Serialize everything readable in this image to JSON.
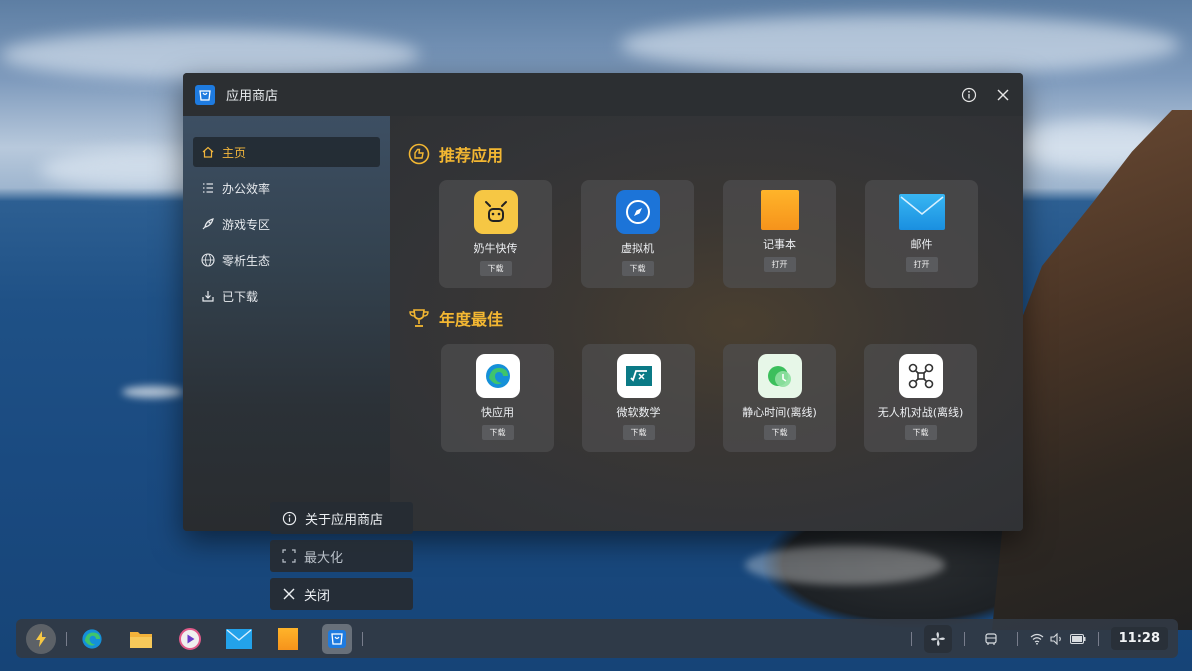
{
  "window": {
    "title": "应用商店"
  },
  "sidebar": {
    "items": [
      {
        "label": "主页",
        "icon": "home-icon",
        "active": true
      },
      {
        "label": "办公效率",
        "icon": "list-icon"
      },
      {
        "label": "游戏专区",
        "icon": "rocket-icon"
      },
      {
        "label": "零析生态",
        "icon": "www-icon"
      },
      {
        "label": "已下载",
        "icon": "download-tray-icon"
      }
    ]
  },
  "sections": [
    {
      "title": "推荐应用",
      "icon": "thumb-badge-icon",
      "apps": [
        {
          "name": "奶牛快传",
          "button": "下载",
          "icon": "cow-icon",
          "color": "#f6c744"
        },
        {
          "name": "虚拟机",
          "button": "下载",
          "icon": "compass-icon",
          "color": "#1c74d8"
        },
        {
          "name": "记事本",
          "button": "打开",
          "icon": "notepad-icon",
          "color": "#f6a21c"
        },
        {
          "name": "邮件",
          "button": "打开",
          "icon": "mail-icon",
          "color": "#23a2ea"
        }
      ]
    },
    {
      "title": "年度最佳",
      "icon": "trophy-icon",
      "apps": [
        {
          "name": "快应用",
          "button": "下载",
          "icon": "edge-icon",
          "color": "#ffffff"
        },
        {
          "name": "微软数学",
          "button": "下载",
          "icon": "math-icon",
          "color": "#ffffff"
        },
        {
          "name": "静心时间(离线)",
          "button": "下载",
          "icon": "clock-app-icon",
          "color": "#e7f7e8"
        },
        {
          "name": "无人机对战(离线)",
          "button": "下载",
          "icon": "drone-icon",
          "color": "#ffffff"
        }
      ]
    }
  ],
  "context_menu": {
    "about": "关于应用商店",
    "maximize": "最大化",
    "close": "关闭"
  },
  "taskbar": {
    "clock": "11:28"
  },
  "colors": {
    "accent": "#f3b732",
    "brand": "#1e7be0"
  }
}
